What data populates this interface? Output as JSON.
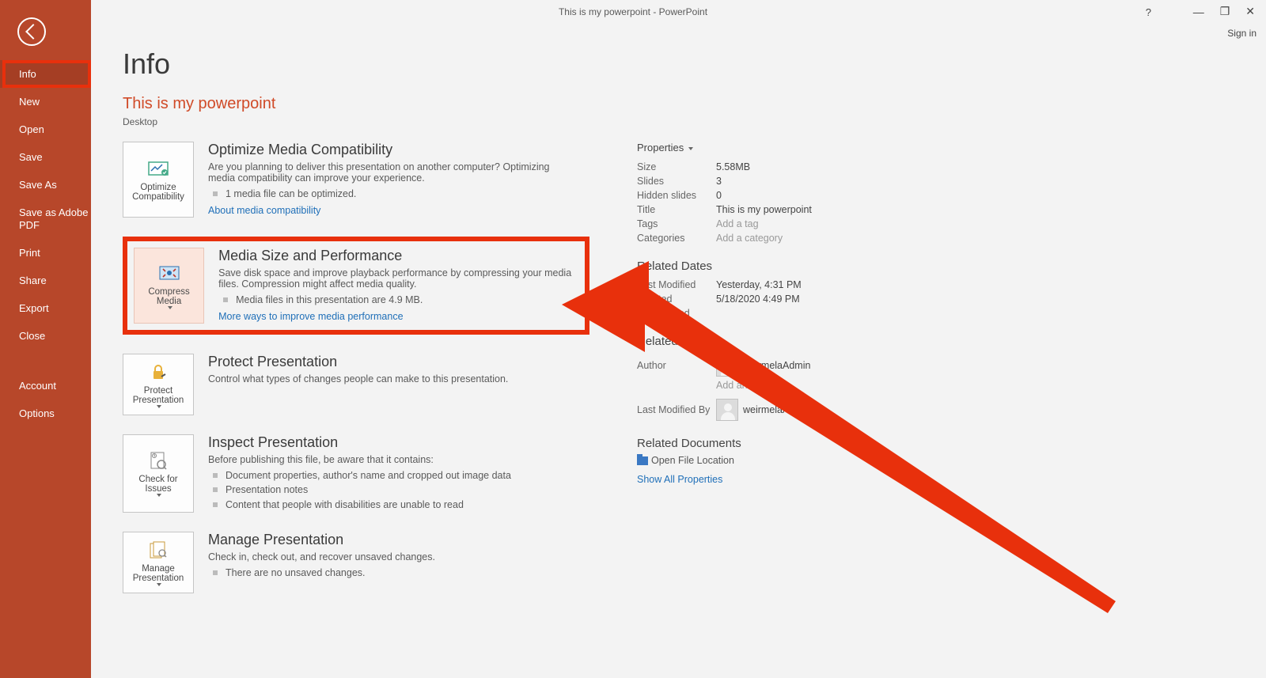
{
  "titlebar": {
    "title": "This is my powerpoint - PowerPoint",
    "help": "?",
    "signin": "Sign in"
  },
  "sidebar": {
    "items": [
      "Info",
      "New",
      "Open",
      "Save",
      "Save As",
      "Save as Adobe PDF",
      "Print",
      "Share",
      "Export",
      "Close"
    ],
    "lower": [
      "Account",
      "Options"
    ]
  },
  "page": {
    "title": "Info",
    "filename": "This is my powerpoint",
    "location": "Desktop"
  },
  "blocks": {
    "optimize": {
      "btn": "Optimize Compatibility",
      "heading": "Optimize Media Compatibility",
      "desc": "Are you planning to deliver this presentation on another computer? Optimizing media compatibility can improve your experience.",
      "bullets": [
        "1 media file can be optimized."
      ],
      "link": "About media compatibility"
    },
    "compress": {
      "btn": "Compress Media",
      "heading": "Media Size and Performance",
      "desc": "Save disk space and improve playback performance by compressing your media files. Compression might affect media quality.",
      "bullets": [
        "Media files in this presentation are 4.9 MB."
      ],
      "link": "More ways to improve media performance"
    },
    "protect": {
      "btn": "Protect Presentation",
      "heading": "Protect Presentation",
      "desc": "Control what types of changes people can make to this presentation."
    },
    "inspect": {
      "btn": "Check for Issues",
      "heading": "Inspect Presentation",
      "desc": "Before publishing this file, be aware that it contains:",
      "bullets": [
        "Document properties, author's name and cropped out image data",
        "Presentation notes",
        "Content that people with disabilities are unable to read"
      ]
    },
    "manage": {
      "btn": "Manage Presentation",
      "heading": "Manage Presentation",
      "desc": "Check in, check out, and recover unsaved changes.",
      "bullets": [
        "There are no unsaved changes."
      ]
    }
  },
  "props": {
    "heading": "Properties",
    "rows": {
      "size_l": "Size",
      "size_v": "5.58MB",
      "slides_l": "Slides",
      "slides_v": "3",
      "hidden_l": "Hidden slides",
      "hidden_v": "0",
      "title_l": "Title",
      "title_v": "This is my powerpoint",
      "tags_l": "Tags",
      "tags_v": "Add a tag",
      "cat_l": "Categories",
      "cat_v": "Add a category"
    },
    "dates_h": "Related Dates",
    "dates": {
      "lm_l": "Last Modified",
      "lm_v": "Yesterday, 4:31 PM",
      "cr_l": "Created",
      "cr_v": "5/18/2020 4:49 PM",
      "lp_l": "Last Printed",
      "lp_v": ""
    },
    "people_h": "Related People",
    "people": {
      "author_l": "Author",
      "author_v": "weirmelaAdmin",
      "addauthor": "Add an author",
      "lmb_l": "Last Modified By",
      "lmb_v": "weirmelaAdmin"
    },
    "docs_h": "Related Documents",
    "openloc": "Open File Location",
    "showall": "Show All Properties"
  }
}
